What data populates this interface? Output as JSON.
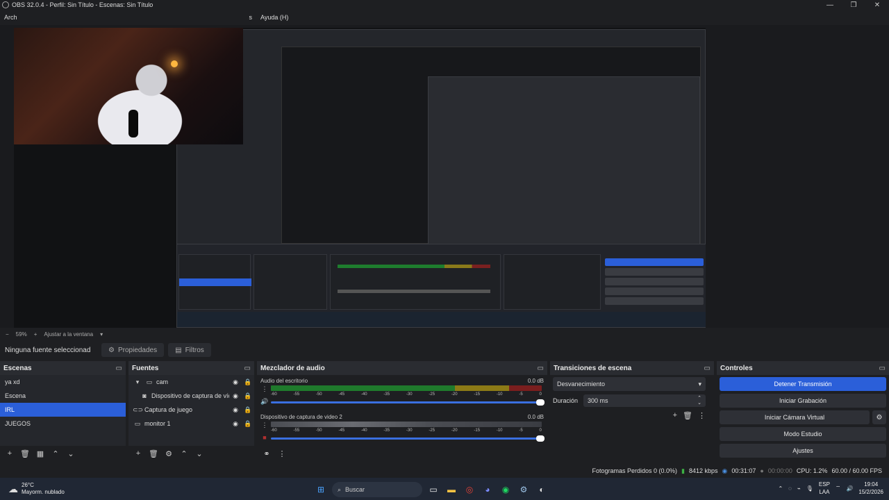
{
  "window": {
    "title": "OBS 32.0.4 - Perfil: Sin Título - Escenas: Sin Título",
    "controls": [
      "minimize-icon",
      "restore-icon",
      "close-icon"
    ]
  },
  "menubar": {
    "partial_left": "Arch",
    "partial_mid": "s",
    "help": "Ayuda (H)"
  },
  "preview": {
    "zoom_percent": "59%",
    "fit": "Ajustar a la ventana"
  },
  "source_toolbar": {
    "no_source": "Ninguna fuente seleccionad",
    "properties": "Propiedades",
    "filters": "Filtros"
  },
  "scenes": {
    "title": "Escenas",
    "items": [
      {
        "label": "ya xd"
      },
      {
        "label": "Escena"
      },
      {
        "label": "IRL"
      },
      {
        "label": "JUEGOS"
      }
    ],
    "selected_index": 2
  },
  "sources": {
    "title": "Fuentes",
    "items": [
      {
        "label": "cam",
        "icon": "folder-icon",
        "indent": 0
      },
      {
        "label": "Dispositivo de captura de víd",
        "icon": "camera-icon",
        "indent": 1
      },
      {
        "label": "Captura de juego",
        "icon": "gamepad-icon",
        "indent": 0
      },
      {
        "label": "monitor 1",
        "icon": "monitor-icon",
        "indent": 0
      }
    ]
  },
  "mixer": {
    "title": "Mezclador de audio",
    "tracks": [
      {
        "name": "Audio del escritorio",
        "db": "0.0 dB"
      },
      {
        "name": "Dispositivo de captura de video 2",
        "db": "0.0 dB"
      }
    ],
    "scale": [
      "-60",
      "-55",
      "-50",
      "-45",
      "-40",
      "-35",
      "-30",
      "-25",
      "-20",
      "-15",
      "-10",
      "-5",
      "0"
    ]
  },
  "transitions": {
    "title": "Transiciones de escena",
    "selected": "Desvanecimiento",
    "duration_label": "Duración",
    "duration_value": "300 ms"
  },
  "controls": {
    "title": "Controles",
    "buttons": {
      "stream": "Detener Transmisión",
      "record": "Iniciar Grabación",
      "virtual_cam": "Iniciar Cámara Virtual",
      "studio": "Modo Estudio",
      "settings": "Ajustes"
    }
  },
  "status": {
    "dropped": "Fotogramas Perdidos 0 (0.0%)",
    "bitrate": "8412 kbps",
    "stream_time": "00:31:07",
    "record_time": "00:00:00",
    "cpu": "CPU: 1.2%",
    "fps": "60.00 / 60.00 FPS"
  },
  "taskbar": {
    "weather_temp": "26°C",
    "weather_desc": "Mayorm. nublado",
    "search": "Buscar",
    "lang1": "ESP",
    "lang2": "LAA",
    "time": "19:04",
    "date": "15/2/2026"
  },
  "colors": {
    "accent": "#2b5fd9",
    "panel": "#25272c",
    "background": "#1e1f22"
  }
}
